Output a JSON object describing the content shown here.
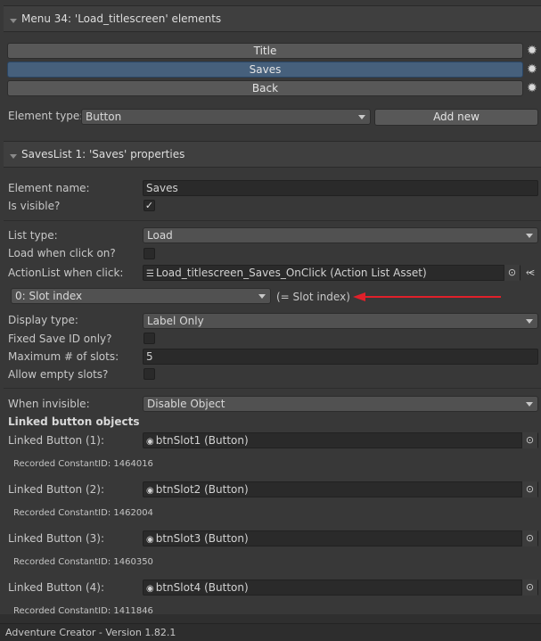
{
  "menu_section": {
    "title": "Menu 34: 'Load_titlescreen' elements",
    "elements": [
      {
        "label": "Title",
        "selected": false
      },
      {
        "label": "Saves",
        "selected": true
      },
      {
        "label": "Back",
        "selected": false
      }
    ],
    "element_type_label": "Element type:",
    "element_type_value": "Button",
    "add_new_label": "Add new"
  },
  "props_section": {
    "title": "SavesList 1: 'Saves' properties",
    "element_name_label": "Element name:",
    "element_name_value": "Saves",
    "is_visible_label": "Is visible?",
    "is_visible_checked": "✓",
    "list_type_label": "List type:",
    "list_type_value": "Load",
    "load_when_click_label": "Load when click on?",
    "actionlist_label": "ActionList when click:",
    "actionlist_value": "Load_titlescreen_Saves_OnClick (Action List Asset)",
    "slot_param_value": "0: Slot index",
    "slot_param_hint": "(= Slot index)",
    "display_type_label": "Display type:",
    "display_type_value": "Label Only",
    "fixed_save_label": "Fixed Save ID only?",
    "max_slots_label": "Maximum # of slots:",
    "max_slots_value": "5",
    "allow_empty_label": "Allow empty slots?",
    "when_invisible_label": "When invisible:",
    "when_invisible_value": "Disable Object",
    "linked_header": "Linked button objects",
    "linked_buttons": [
      {
        "label": "Linked Button (1):",
        "value": "btnSlot1 (Button)",
        "recorded": "Recorded ConstantID: 1464016"
      },
      {
        "label": "Linked Button (2):",
        "value": "btnSlot2 (Button)",
        "recorded": "Recorded ConstantID: 1462004"
      },
      {
        "label": "Linked Button (3):",
        "value": "btnSlot3 (Button)",
        "recorded": "Recorded ConstantID: 1460350"
      },
      {
        "label": "Linked Button (4):",
        "value": "btnSlot4 (Button)",
        "recorded": "Recorded ConstantID: 1411846"
      }
    ]
  },
  "footer": {
    "text": "Adventure Creator - Version 1.82.1"
  },
  "colors": {
    "accent_selected": "#46607c",
    "annotation_arrow": "#e0202a"
  }
}
